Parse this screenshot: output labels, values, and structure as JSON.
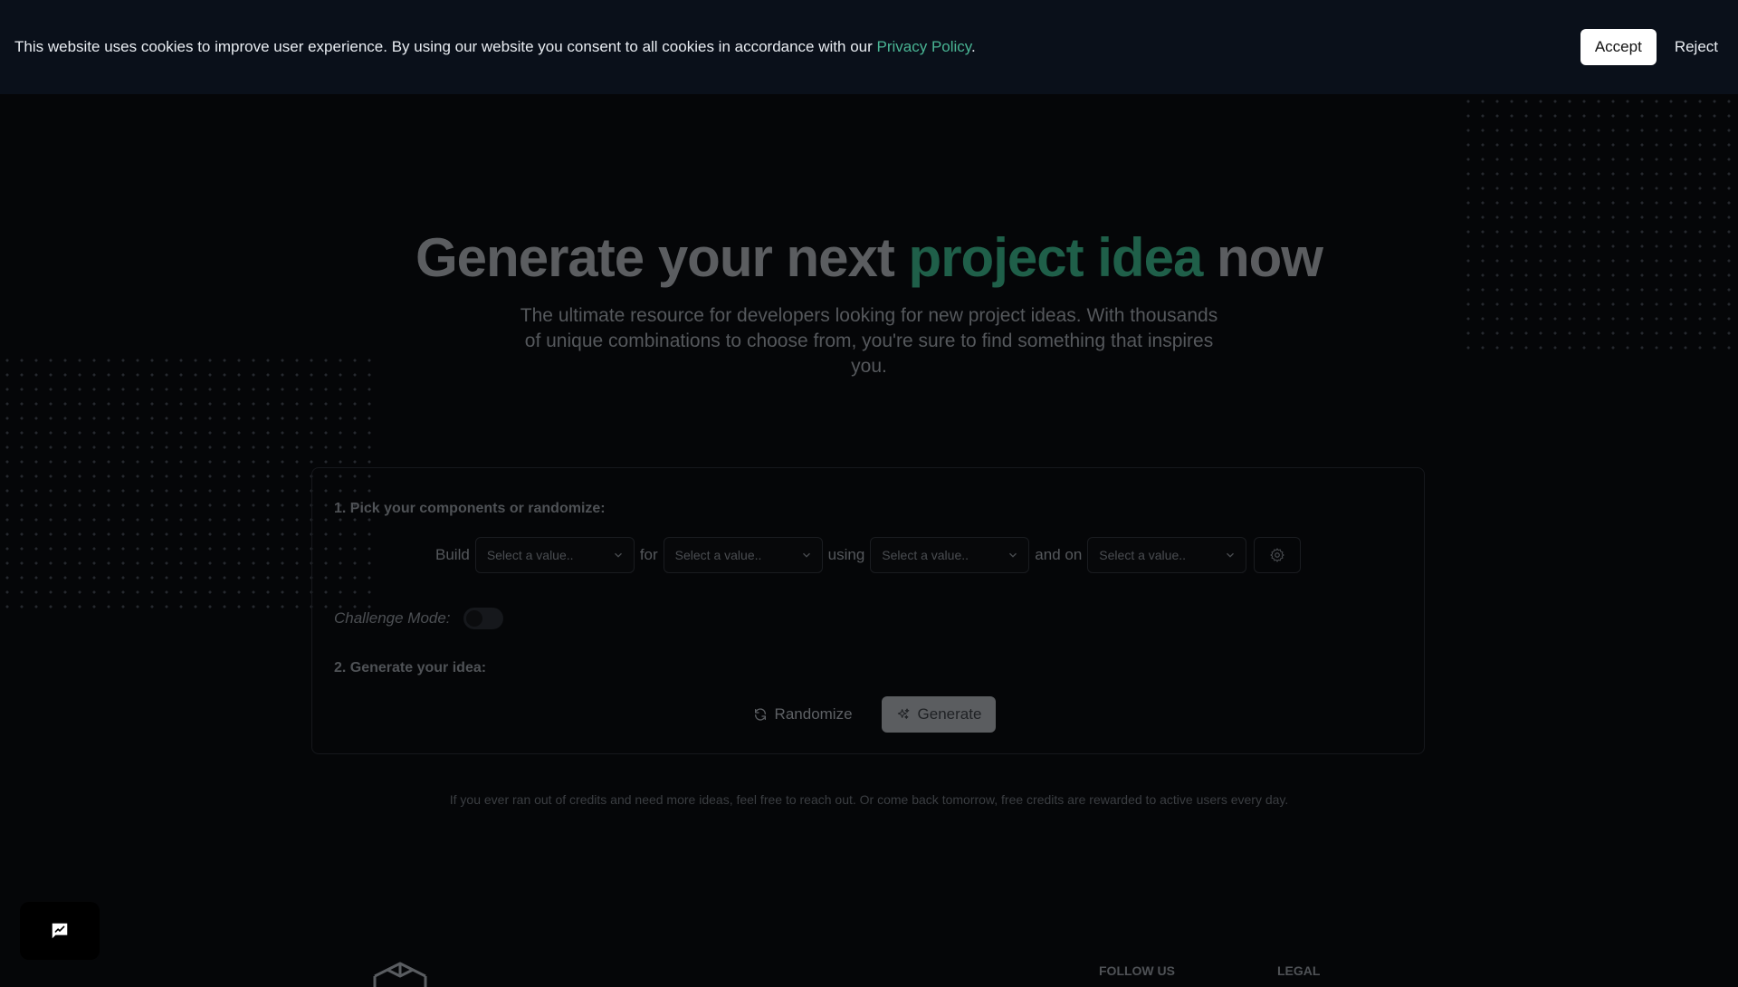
{
  "cookie_banner": {
    "message": "This website uses cookies to improve user experience. By using our website you consent to all cookies in accordance with our ",
    "link": "Privacy Policy",
    "period": ".",
    "accept": "Accept",
    "reject": "Reject"
  },
  "hero": {
    "title_before": "Generate your next ",
    "title_accent": "project idea",
    "title_after": " now",
    "subtitle": "The ultimate resource for developers looking for new project ideas. With thousands of unique combinations to choose from, you're sure to find something that inspires you."
  },
  "form": {
    "step1": "1. Pick your components or randomize:",
    "builder": {
      "build": "Build",
      "for": "for",
      "using": "using",
      "and_on": "and on",
      "placeholder": "Select a value.."
    },
    "challenge_label": "Challenge Mode:",
    "challenge_on": false,
    "step2": "2. Generate your idea:",
    "randomize": "Randomize",
    "generate": "Generate"
  },
  "note": "If you ever ran out of credits and need more ideas, feel free to reach out. Or come back tomorrow, free credits are rewarded to active users every day.",
  "footer": {
    "follow_us": "FOLLOW US",
    "legal": "LEGAL"
  },
  "colors": {
    "background": "#050608",
    "cookie_bar": "#0a101a",
    "accent_green": "#49b594",
    "title_accent_dim": "#1f5f49"
  },
  "icons": [
    "chevron-down-icon",
    "settings-gear-icon",
    "refresh-icon",
    "sparkles-icon",
    "feedback-chat-icon",
    "cube-logo-icon"
  ]
}
